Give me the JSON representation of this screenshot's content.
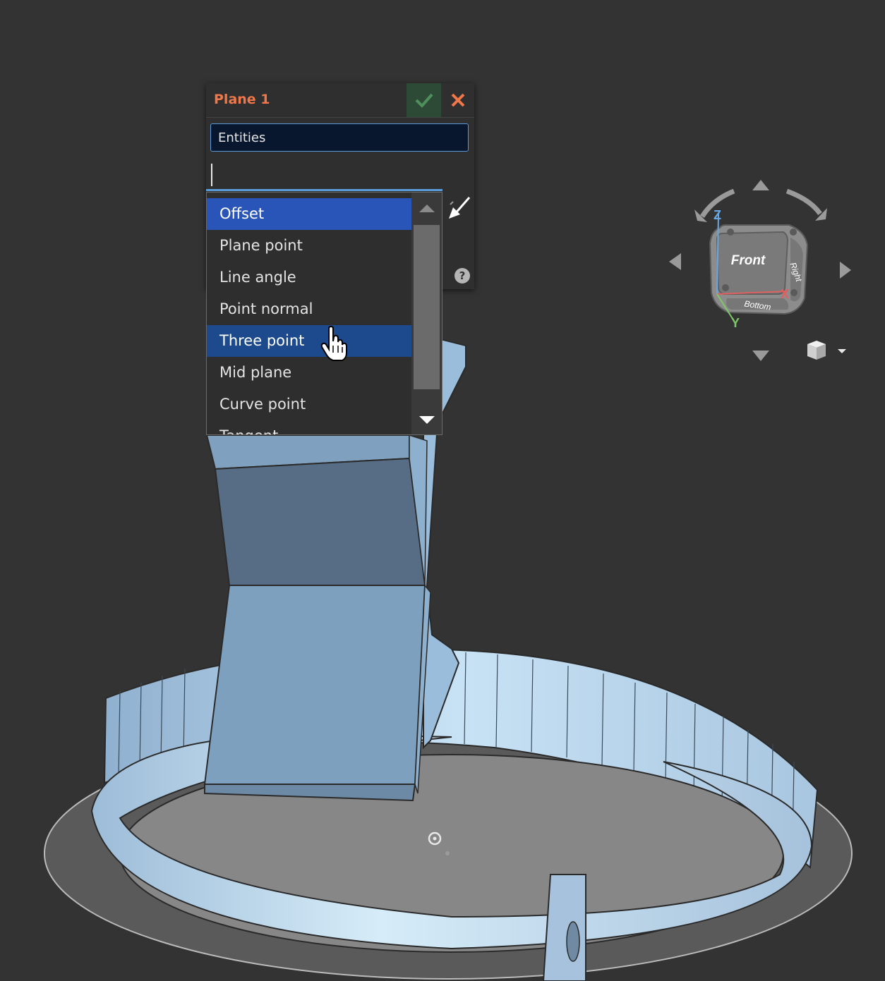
{
  "dialog": {
    "title": "Plane 1",
    "entities_label": "Entities",
    "help_glyph": "?",
    "icons": [
      "check-icon",
      "close-icon",
      "flip-arrow-icon",
      "help-icon"
    ]
  },
  "dropdown": {
    "items": [
      "Offset",
      "Plane point",
      "Line angle",
      "Point normal",
      "Three point",
      "Mid plane",
      "Curve point",
      "Tangent"
    ],
    "selected": "Offset",
    "hovered": "Three point"
  },
  "view_cube": {
    "faces": {
      "front": "Front",
      "right": "Right",
      "bottom": "Bottom"
    },
    "axes": {
      "x": "X",
      "y": "Y",
      "z": "Z"
    },
    "axis_colors": {
      "x": "#e06060",
      "y": "#7ec86a",
      "z": "#6aa7e0"
    }
  },
  "colors": {
    "accent_title": "#f0774a",
    "selected": "#2a55b8",
    "hover": "#1d4a8c",
    "model_blue": "#86aed4",
    "background": "#333333"
  }
}
